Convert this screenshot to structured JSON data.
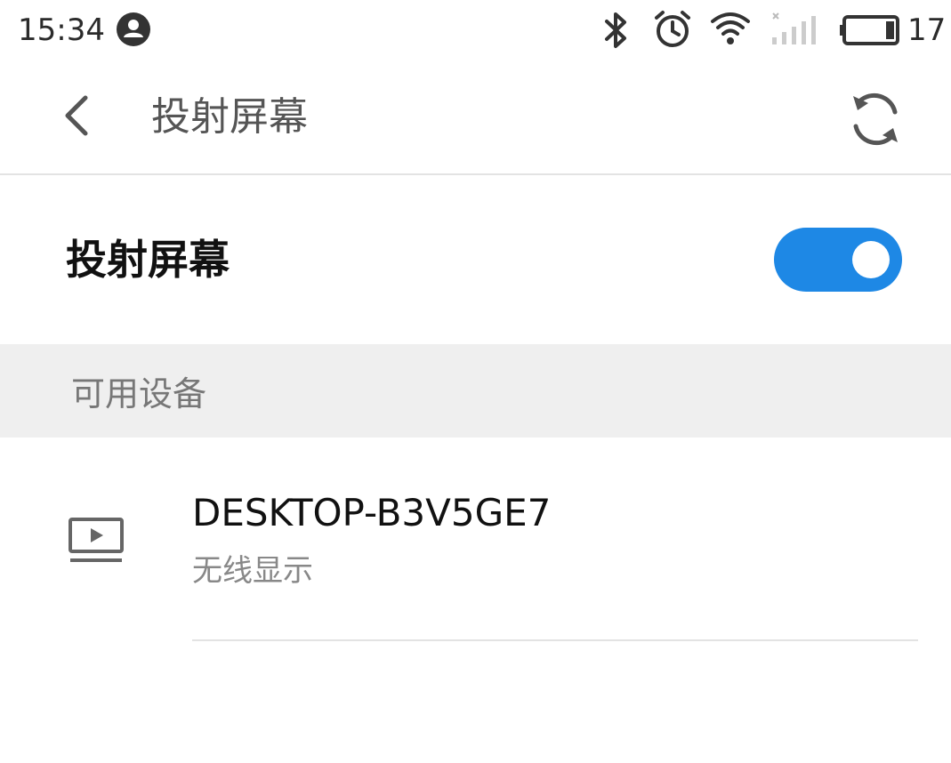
{
  "status_bar": {
    "time": "15:34",
    "battery_level": "17",
    "icons": [
      "account-icon",
      "bluetooth-icon",
      "alarm-icon",
      "wifi-icon",
      "no-signal-icon",
      "battery-icon"
    ]
  },
  "app_bar": {
    "title": "投射屏幕",
    "back_icon": "chevron-left-icon",
    "refresh_icon": "refresh-icon"
  },
  "toggle": {
    "label": "投射屏幕",
    "enabled": true,
    "accent_color": "#1e88e5"
  },
  "section": {
    "title": "可用设备"
  },
  "devices": [
    {
      "name": "DESKTOP-B3V5GE7",
      "type": "无线显示",
      "icon": "cast-display-icon"
    }
  ]
}
